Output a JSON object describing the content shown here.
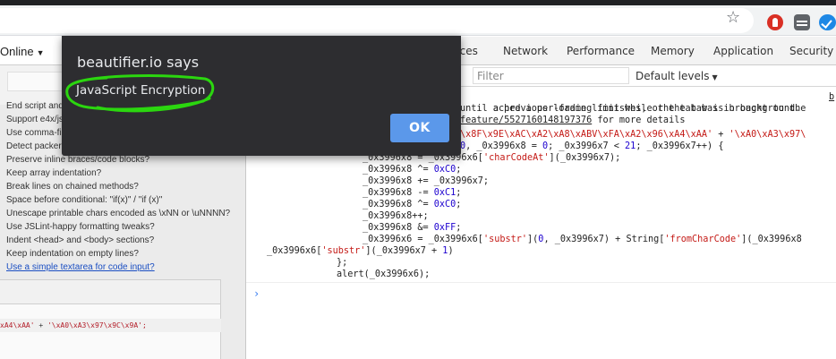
{
  "browser": {
    "bookmark_icon": "star-icon",
    "extensions": [
      "adblock-hand-icon",
      "tab-manager-icon",
      "check-circle-icon"
    ]
  },
  "left_page": {
    "mode_select": {
      "label": "Online",
      "caret": "▼"
    },
    "options": [
      "End script and",
      "Support e4x/jsx",
      "Use comma-firs",
      "Detect packers",
      "Preserve inline braces/code blocks?",
      "Keep array indentation?",
      "Break lines on chained methods?",
      "Space before conditional: \"if(x)\" / \"if (x)\"",
      "Unescape printable chars encoded as \\xNN or \\uNNNN?",
      "Use JSLint-happy formatting tweaks?",
      "Indent <head> and <body> sections?",
      "Keep indentation on empty lines?"
    ],
    "textarea_link": "Use a simple textarea for code input?",
    "output_snippet": {
      "s1": "xA4\\xAA'",
      "op": " + ",
      "s2": "'\\xA0\\xA3\\x97\\x9C\\x9A';"
    }
  },
  "devtools": {
    "tabs": [
      "rces",
      "Network",
      "Performance",
      "Memory",
      "Application",
      "Security"
    ],
    "filter_placeholder": "Filter",
    "levels": {
      "label": "Default levels",
      "caret": "▼"
    },
    "console": {
      "warning": {
        "line1": "ached a per-frame limit while the tab was in background.",
        "line1_source": "b",
        "line2": "until a previous loading finishes, or the tab is brought to the",
        "line3_link": "feature/5527160148197376",
        "line3_rest": " for more details"
      },
      "code": {
        "l1a": "\\x8F\\x9E\\xAC\\xA2\\xA8\\xABV\\xFA\\xA2\\x96\\xA4\\xAA'",
        "l1b": " + ",
        "l1c": "'\\xA0\\xA3\\x97\\",
        "l2a": "0",
        "l2b": ", _0x3996x8 = ",
        "l2c": "0",
        "l2d": "; _0x3996x7 < ",
        "l2e": "21",
        "l2f": "; _0x3996x7++) {",
        "l3a": "_0x3996x8 = _0x3996x6[",
        "l3b": "'charCodeAt'",
        "l3c": "](_0x3996x7);",
        "l4a": "_0x3996x8 ^= ",
        "l4b": "0xC0",
        "l4c": ";",
        "l5": "_0x3996x8 += _0x3996x7;",
        "l6a": "_0x3996x8 -= ",
        "l6b": "0xC1",
        "l6c": ";",
        "l7a": "_0x3996x8 ^= ",
        "l7b": "0xC0",
        "l7c": ";",
        "l8": "_0x3996x8++;",
        "l9a": "_0x3996x8 &= ",
        "l9b": "0xFF",
        "l9c": ";",
        "l10a": "_0x3996x6 = _0x3996x6[",
        "l10b": "'substr'",
        "l10c": "](",
        "l10d": "0",
        "l10e": ", _0x3996x7) + String[",
        "l10f": "'fromCharCode'",
        "l10g": "](_0x3996x8",
        "l11a": "_0x3996x6[",
        "l11b": "'substr'",
        "l11c": "](_0x3996x7 + ",
        "l11d": "1",
        "l11e": ")",
        "l12": "};",
        "l13": "alert(_0x3996x6);"
      },
      "prompt": "›"
    }
  },
  "dialog": {
    "title": "beautifier.io says",
    "message": "JavaScript Encryption",
    "ok_label": "OK",
    "annotation_color": "#2bd60f",
    "button_color": "#5b98ea"
  }
}
